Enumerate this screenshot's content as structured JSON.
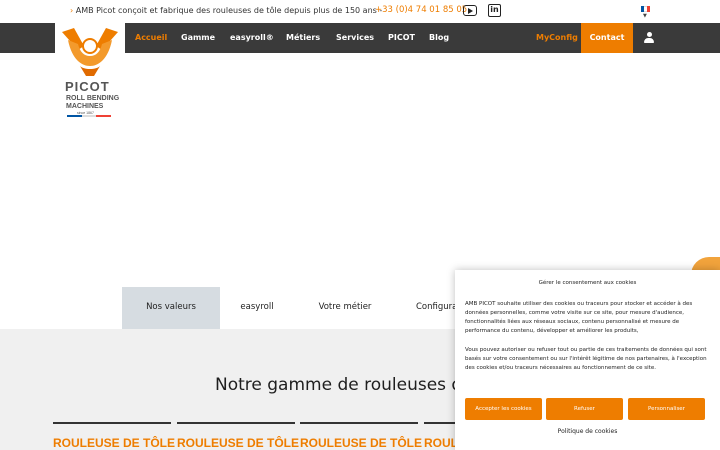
{
  "topbar": {
    "tagline_arrow": "›",
    "tagline": "AMB Picot conçoit et fabrique des rouleuses de tôle depuis plus de 150 ans -",
    "phone": "+33 (0)4 74 01 85 05",
    "social": [
      "youtube-icon",
      "linkedin-icon"
    ],
    "linkedin_glyph": "in",
    "language": "FR",
    "flag_colors": [
      "#0055a4",
      "#ffffff",
      "#ef4135"
    ]
  },
  "logo": {
    "brand": "PICOT",
    "line1": "ROLL BENDING",
    "line2": "MACHINES",
    "since": "since 1867",
    "colors": {
      "orange": "#ee7d00",
      "gray": "#555555"
    }
  },
  "nav": {
    "items": [
      "Accueil",
      "Gamme",
      "easyroll®",
      "Métiers",
      "Services",
      "PICOT",
      "Blog"
    ],
    "active": "Accueil",
    "myconfig": "MyConfig",
    "contact": "Contact"
  },
  "tabs": {
    "items": [
      "Nos valeurs",
      "easyroll",
      "Votre métier",
      "Configura"
    ],
    "active": "Nos valeurs"
  },
  "section": {
    "title": "Notre gamme de rouleuses d",
    "cards": [
      "ROULEUSE DE TÔLE",
      "ROULEUSE DE TÔLE",
      "ROULEUSE DE TÔLE",
      "ROULEUSE DE TÔLE"
    ]
  },
  "cookie": {
    "title": "Gérer le consentement aux cookies",
    "para1": "AMB PICOT souhaite utiliser des cookies ou traceurs pour stocker et accéder à des données personnelles, comme votre visite sur ce site, pour mesure d'audience, fonctionnalités liées aux réseaux sociaux, contenu personnalisé et mesure de performance du contenu, développer et améliorer les produits,",
    "para2": "Vous pouvez autoriser ou refuser tout ou partie de ces traitements de données qui sont basés sur votre consentement ou sur l'intérêt légitime de nos partenaires, à l'exception des cookies et/ou traceurs nécessaires au fonctionnement de ce site.",
    "accept": "Accepter les cookies",
    "refuse": "Refuser",
    "customize": "Personnaliser",
    "policy": "Politique de cookies"
  },
  "colors": {
    "accent": "#ee7d00",
    "nav_bg": "#3a3a3a",
    "tab_active": "#d6dce1",
    "section_bg": "#f0f0f0"
  }
}
